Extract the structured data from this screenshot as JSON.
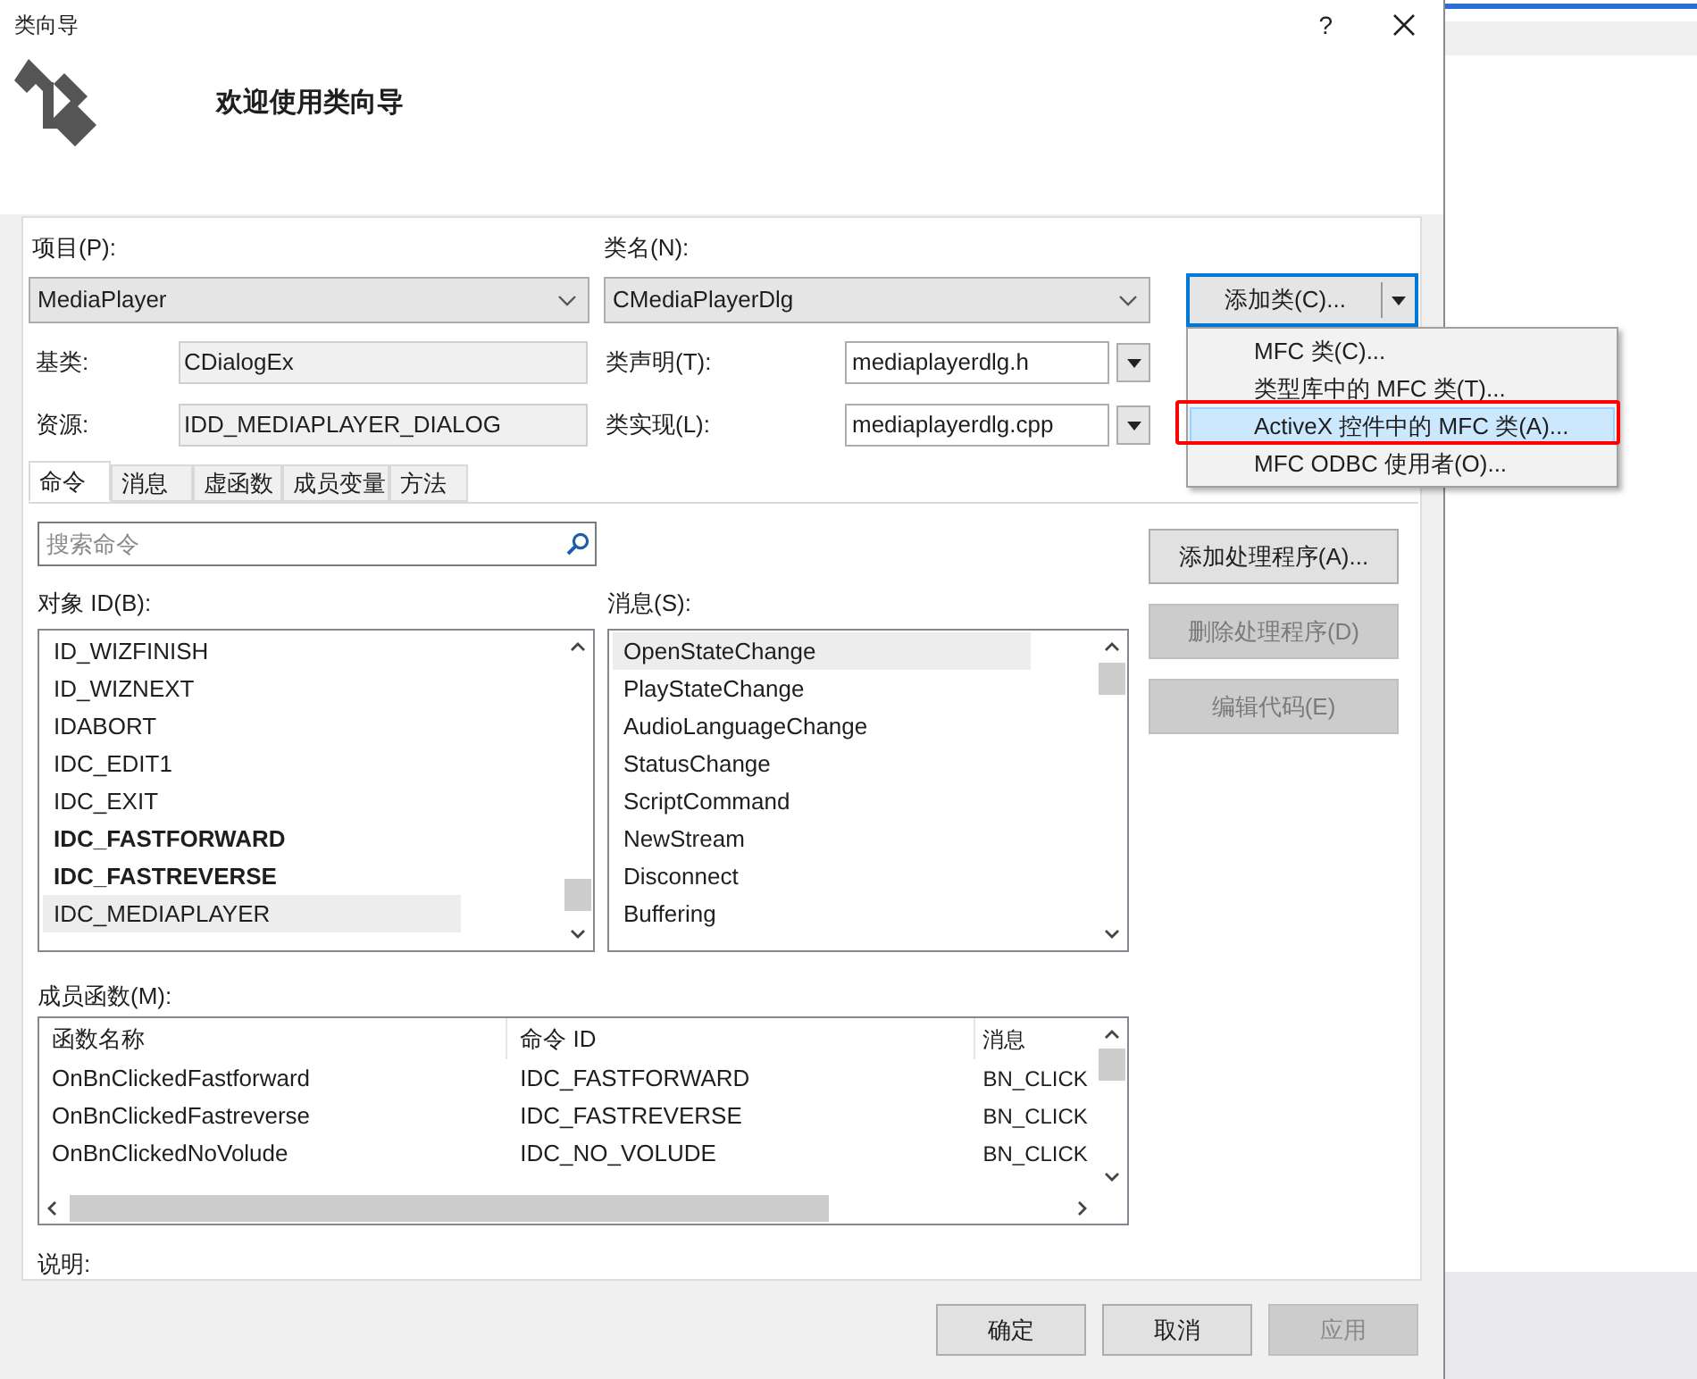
{
  "window": {
    "title": "类向导",
    "help": "?"
  },
  "header": {
    "title": "欢迎使用类向导"
  },
  "project": {
    "label": "项目(P):",
    "value": "MediaPlayer"
  },
  "class_name": {
    "label": "类名(N):",
    "value": "CMediaPlayerDlg"
  },
  "add_class_button": {
    "label": "添加类(C)..."
  },
  "add_class_menu": [
    {
      "label": "MFC 类(C)...",
      "selected": false
    },
    {
      "label": "类型库中的 MFC 类(T)...",
      "selected": false
    },
    {
      "label": "ActiveX 控件中的 MFC 类(A)...",
      "selected": true
    },
    {
      "label": "MFC ODBC 使用者(O)...",
      "selected": false
    }
  ],
  "base_class": {
    "label": "基类:",
    "value": "CDialogEx"
  },
  "class_declaration": {
    "label": "类声明(T):",
    "value": "mediaplayerdlg.h"
  },
  "resource": {
    "label": "资源:",
    "value": "IDD_MEDIAPLAYER_DIALOG"
  },
  "class_implementation": {
    "label": "类实现(L):",
    "value": "mediaplayerdlg.cpp"
  },
  "tabs": [
    {
      "label": "命令",
      "selected": true
    },
    {
      "label": "消息",
      "selected": false
    },
    {
      "label": "虚函数",
      "selected": false
    },
    {
      "label": "成员变量",
      "selected": false
    },
    {
      "label": "方法",
      "selected": false
    }
  ],
  "search": {
    "placeholder": "搜索命令"
  },
  "handler_buttons": [
    {
      "label": "添加处理程序(A)...",
      "disabled": false
    },
    {
      "label": "删除处理程序(D)",
      "disabled": true
    },
    {
      "label": "编辑代码(E)",
      "disabled": true
    }
  ],
  "object_ids": {
    "label": "对象 ID(B):",
    "items": [
      {
        "text": "ID_WIZFINISH",
        "bold": false,
        "selected": false
      },
      {
        "text": "ID_WIZNEXT",
        "bold": false,
        "selected": false
      },
      {
        "text": "IDABORT",
        "bold": false,
        "selected": false
      },
      {
        "text": "IDC_EDIT1",
        "bold": false,
        "selected": false
      },
      {
        "text": "IDC_EXIT",
        "bold": false,
        "selected": false
      },
      {
        "text": "IDC_FASTFORWARD",
        "bold": true,
        "selected": false
      },
      {
        "text": "IDC_FASTREVERSE",
        "bold": true,
        "selected": false
      },
      {
        "text": "IDC_MEDIAPLAYER",
        "bold": false,
        "selected": true
      }
    ]
  },
  "messages": {
    "label": "消息(S):",
    "items": [
      {
        "text": "OpenStateChange",
        "selected": true
      },
      {
        "text": "PlayStateChange",
        "selected": false
      },
      {
        "text": "AudioLanguageChange",
        "selected": false
      },
      {
        "text": "StatusChange",
        "selected": false
      },
      {
        "text": "ScriptCommand",
        "selected": false
      },
      {
        "text": "NewStream",
        "selected": false
      },
      {
        "text": "Disconnect",
        "selected": false
      },
      {
        "text": "Buffering",
        "selected": false
      }
    ]
  },
  "member_functions": {
    "label": "成员函数(M):",
    "columns": [
      "函数名称",
      "命令 ID",
      "消息"
    ],
    "rows": [
      [
        "OnBnClickedFastforward",
        "IDC_FASTFORWARD",
        "BN_CLICK"
      ],
      [
        "OnBnClickedFastreverse",
        "IDC_FASTREVERSE",
        "BN_CLICK"
      ],
      [
        "OnBnClickedNoVolude",
        "IDC_NO_VOLUDE",
        "BN_CLICK"
      ]
    ]
  },
  "description": {
    "label": "说明:"
  },
  "footer_buttons": [
    {
      "label": "确定",
      "disabled": false
    },
    {
      "label": "取消",
      "disabled": false
    },
    {
      "label": "应用",
      "disabled": true
    }
  ]
}
